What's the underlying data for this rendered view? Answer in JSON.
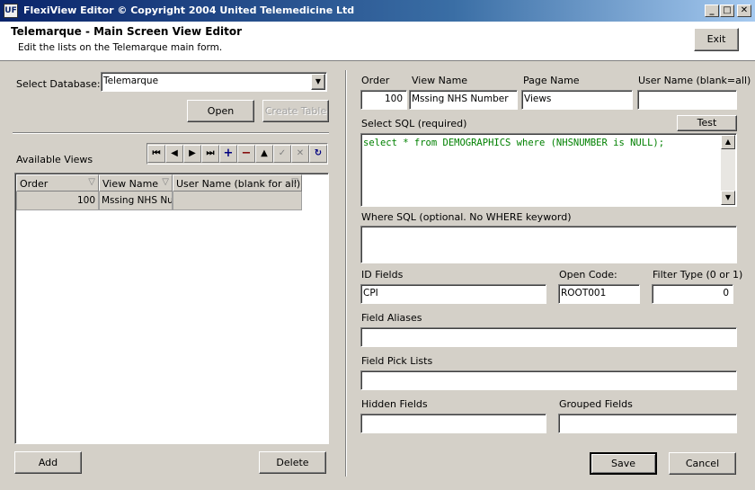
{
  "window": {
    "title": "FlexiView Editor © Copyright 2004 United Telemedicine Ltd",
    "icon": "app-icon",
    "minimize": "_",
    "maximize": "□",
    "close": "✕"
  },
  "header": {
    "title": "Telemarque - Main Screen View Editor",
    "subtitle": "Edit the lists on the Telemarque main form.",
    "exit_label": "Exit"
  },
  "left": {
    "select_db_label": "Select Database:",
    "database_value": "Telemarque",
    "open_label": "Open",
    "create_table_label": "Create Table",
    "available_views_label": "Available Views",
    "nav_icons": [
      "first-icon",
      "prior-icon",
      "next-icon",
      "last-icon",
      "insert-icon",
      "delete-icon",
      "edit-icon",
      "post-icon",
      "cancel-icon",
      "refresh-icon"
    ],
    "nav_glyphs": [
      "⏮",
      "◀",
      "▶",
      "⏭",
      "+",
      "−",
      "▲",
      "✓",
      "✕",
      "↻"
    ],
    "grid": {
      "columns": [
        "Order",
        "View Name",
        "User Name (blank for all)"
      ],
      "rows": [
        [
          "100",
          "Mssing NHS Num",
          ""
        ]
      ]
    },
    "add_label": "Add",
    "delete_label": "Delete"
  },
  "right": {
    "order_label": "Order",
    "order_value": "100",
    "view_name_label": "View Name",
    "view_name_value": "Mssing NHS Number",
    "page_name_label": "Page Name",
    "page_name_value": "Views",
    "user_name_label": "User Name (blank=all)",
    "user_name_value": "",
    "select_sql_label": "Select SQL (required)",
    "test_label": "Test",
    "select_sql_value": "select * from DEMOGRAPHICS where (NHSNUMBER is NULL);",
    "where_sql_label": "Where SQL (optional. No WHERE keyword)",
    "where_sql_value": "",
    "id_fields_label": "ID Fields",
    "id_fields_value": "CPI",
    "open_code_label": "Open Code:",
    "open_code_value": "ROOT001",
    "filter_type_label": "Filter Type (0 or 1)",
    "filter_type_value": "0",
    "field_aliases_label": "Field Aliases",
    "field_aliases_value": "",
    "field_pick_lists_label": "Field Pick Lists",
    "field_pick_lists_value": "",
    "hidden_fields_label": "Hidden Fields",
    "hidden_fields_value": "",
    "grouped_fields_label": "Grouped Fields",
    "grouped_fields_value": "",
    "save_label": "Save",
    "cancel_label": "Cancel"
  },
  "colors": {
    "title_bar": "#0a246a",
    "face": "#d4d0c8",
    "sql_text": "#008000"
  }
}
